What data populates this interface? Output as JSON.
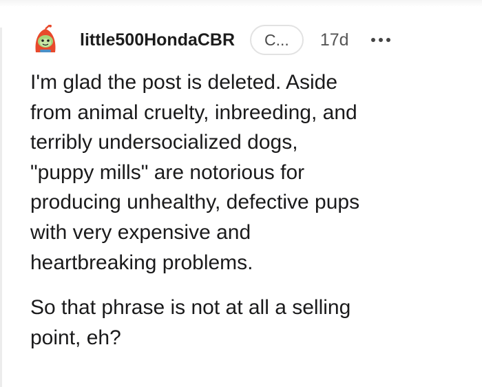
{
  "comment": {
    "username": "little500HondaCBR",
    "flair": "C...",
    "timestamp": "17d",
    "paragraphs": [
      {
        "lines": [
          "I'm glad the post is deleted. Aside",
          "from animal cruelty, inbreeding, and",
          "terribly undersocialized dogs,",
          "\"puppy mills\" are notorious for",
          "producing unhealthy, defective pups",
          "with very expensive and",
          "heartbreaking problems."
        ]
      },
      {
        "lines": [
          "So that phrase is not at all a selling",
          "point, eh?"
        ]
      }
    ]
  },
  "icons": {
    "avatar": "snoo-avatar-icon",
    "more": "more-options-icon"
  },
  "colors": {
    "text": "#1a1a1b",
    "avatar_red": "#e8492c",
    "avatar_green": "#a6d57a",
    "flair_border": "#e2e2e2"
  }
}
